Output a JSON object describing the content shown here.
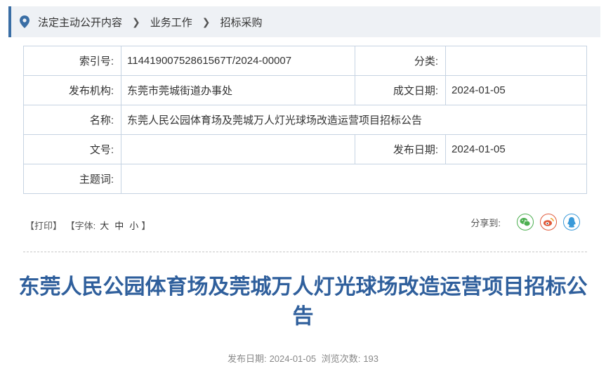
{
  "breadcrumb": {
    "items": [
      "法定主动公开内容",
      "业务工作",
      "招标采购"
    ],
    "separator": "›"
  },
  "meta": {
    "index_label": "索引号:",
    "index_value": "11441900752861567T/2024-00007",
    "category_label": "分类:",
    "category_value": "",
    "publisher_label": "发布机构:",
    "publisher_value": "东莞市莞城街道办事处",
    "created_label": "成文日期:",
    "created_value": "2024-01-05",
    "name_label": "名称:",
    "name_value": "东莞人民公园体育场及莞城万人灯光球场改造运营项目招标公告",
    "docno_label": "文号:",
    "docno_value": "",
    "pubdate_label": "发布日期:",
    "pubdate_value": "2024-01-05",
    "subject_label": "主题词:",
    "subject_value": ""
  },
  "tools": {
    "print": "【打印】",
    "font_prefix": "【字体:",
    "font_large": "大",
    "font_medium": "中",
    "font_small": "小",
    "font_suffix": "】"
  },
  "share": {
    "label": "分享到:",
    "icons": [
      "wechat-icon",
      "weibo-icon",
      "qq-icon"
    ],
    "colors": {
      "wechat": "#4caf50",
      "weibo": "#e0593a",
      "qq": "#3a9ad9"
    }
  },
  "article": {
    "title": "东莞人民公园体育场及莞城万人灯光球场改造运营项目招标公告",
    "pub_label": "发布日期:",
    "pub_date": "2024-01-05",
    "views_label": "浏览次数:",
    "views": "193"
  },
  "colors": {
    "accent": "#3a6ea5",
    "title": "#2f5f9c",
    "border": "#c6d3e2"
  }
}
